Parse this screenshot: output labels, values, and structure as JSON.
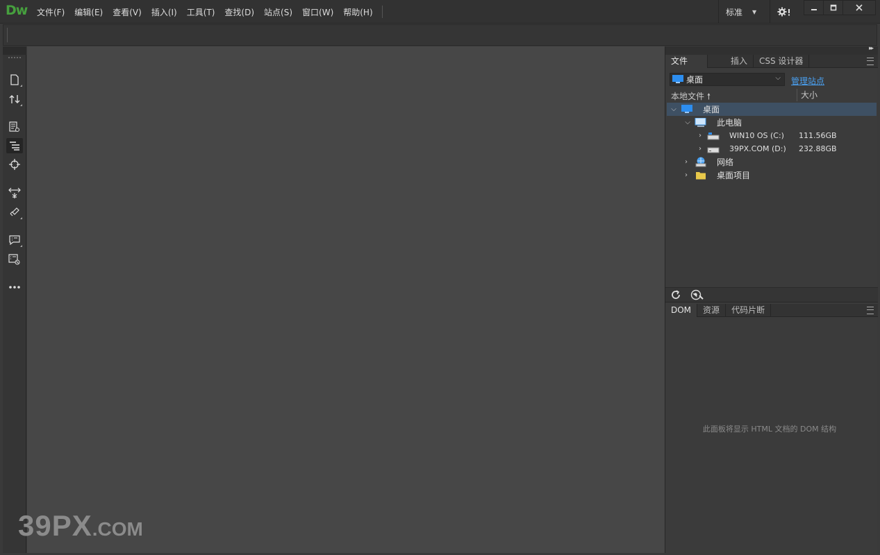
{
  "app": {
    "logo": "Dw"
  },
  "menu": [
    {
      "label": "文件(F)"
    },
    {
      "label": "编辑(E)"
    },
    {
      "label": "查看(V)"
    },
    {
      "label": "插入(I)"
    },
    {
      "label": "工具(T)"
    },
    {
      "label": "查找(D)"
    },
    {
      "label": "站点(S)"
    },
    {
      "label": "窗口(W)"
    },
    {
      "label": "帮助(H)"
    }
  ],
  "workspace": {
    "label": "标准"
  },
  "files_panel": {
    "tabs": [
      "文件",
      "插入",
      "CSS 设计器"
    ],
    "site_select": "桌面",
    "manage_sites": "管理站点",
    "col_local": "本地文件",
    "col_size": "大小",
    "tree": [
      {
        "name": "桌面",
        "size": "",
        "level": 0,
        "expanded": true,
        "icon": "desktop-icon"
      },
      {
        "name": "此电脑",
        "size": "",
        "level": 1,
        "expanded": true,
        "icon": "computer-icon"
      },
      {
        "name": "WIN10 OS (C:)",
        "size": "111.56GB",
        "level": 2,
        "expanded": false,
        "icon": "system-drive-icon"
      },
      {
        "name": "39PX.COM (D:)",
        "size": "232.88GB",
        "level": 2,
        "expanded": false,
        "icon": "drive-icon"
      },
      {
        "name": "网络",
        "size": "",
        "level": 1,
        "expanded": false,
        "icon": "network-icon"
      },
      {
        "name": "桌面项目",
        "size": "",
        "level": 1,
        "expanded": false,
        "icon": "folder-icon"
      }
    ]
  },
  "dom_panel": {
    "tabs": [
      "DOM",
      "资源",
      "代码片断"
    ],
    "message": "此面板将显示 HTML 文档的 DOM 结构"
  },
  "watermark": {
    "big": "39PX",
    "small": ".COM"
  },
  "colors": {
    "accent": "#46a03e",
    "selection": "#3e5063",
    "link": "#4aa0f0"
  }
}
